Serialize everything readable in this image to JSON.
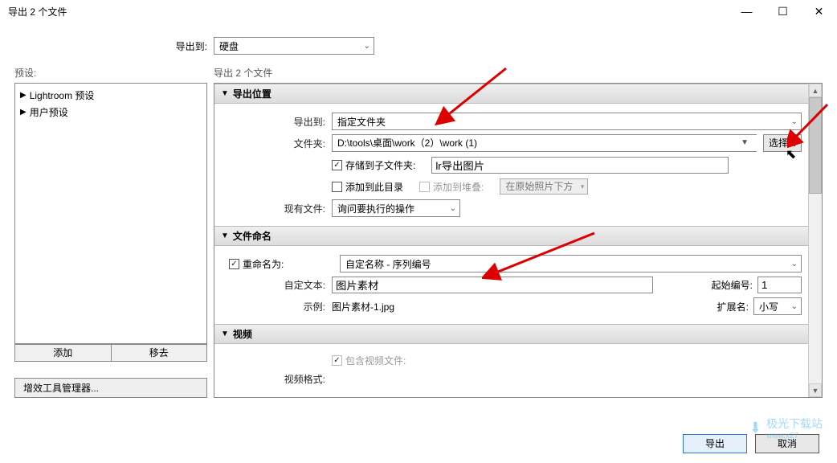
{
  "window": {
    "title": "导出 2 个文件",
    "controls": {
      "min": "—",
      "max": "☐",
      "close": "✕"
    }
  },
  "exportTo": {
    "label": "导出到:",
    "value": "硬盘"
  },
  "presets": {
    "header": "预设:",
    "items": [
      {
        "label": "Lightroom 预设"
      },
      {
        "label": "用户预设"
      }
    ],
    "addBtn": "添加",
    "removeBtn": "移去",
    "pluginMgr": "增效工具管理器..."
  },
  "rightHeader": "导出 2 个文件",
  "sections": {
    "exportLocation": {
      "title": "导出位置",
      "destLabel": "导出到:",
      "destValue": "指定文件夹",
      "folderLabel": "文件夹:",
      "folderValue": "D:\\tools\\桌面\\work（2）\\work (1)",
      "chooseBtn": "选择...",
      "saveSub": "存储到子文件夹:",
      "subValue": "lr导出图片",
      "addDir": "添加到此目录",
      "addStack": "添加到堆叠:",
      "stackPos": "在原始照片下方",
      "existingLabel": "现有文件:",
      "existingValue": "询问要执行的操作"
    },
    "naming": {
      "title": "文件命名",
      "renameLabel": "重命名为:",
      "renameValue": "自定名称 - 序列编号",
      "customLabel": "自定文本:",
      "customValue": "图片素材",
      "startLabel": "起始编号:",
      "startValue": "1",
      "exampleLabel": "示例:",
      "exampleValue": "图片素材-1.jpg",
      "extLabel": "扩展名:",
      "extValue": "小写"
    },
    "video": {
      "title": "视频",
      "includeLabel": "包含视频文件:",
      "formatLabel": "视频格式:"
    }
  },
  "footer": {
    "export": "导出",
    "cancel": "取消"
  },
  "watermark": {
    "text": "极光下载站",
    "url": "www.x27"
  }
}
